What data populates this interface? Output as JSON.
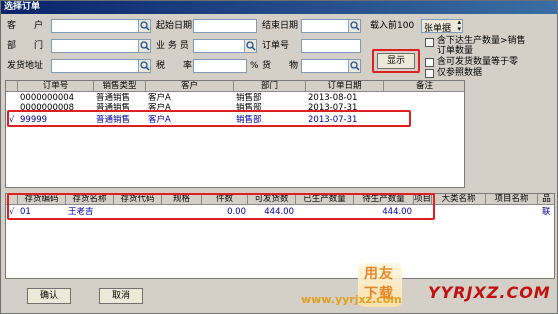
{
  "window": {
    "title": "选择订单"
  },
  "filters": {
    "customer_label": "客　　户",
    "start_date_label": "起始日期",
    "end_date_label": "结束日期",
    "load_prev_label": "载入前100",
    "sheet_sort_value": "张单据",
    "dept_label": "部　　门",
    "salesman_label": "业 务 员",
    "order_no_label": "订单号",
    "ship_addr_label": "发货地址",
    "tax_label": "税　　率",
    "percent_unit": "%",
    "goods_label": "货　　物",
    "show_button": "显示",
    "opt_incl_prod_line1": "含下达生产数量>销售",
    "opt_incl_prod_line2": "订单数量",
    "opt_ship_eq_zero": "含可发货数量等于零",
    "opt_ref_only": "仅参照数据"
  },
  "orders": {
    "columns": [
      "订单号",
      "销售类型",
      "客户",
      "部门",
      "订单日期",
      "备注"
    ],
    "rows": [
      {
        "no": "0000000004",
        "type": "普通销售",
        "customer": "客户A",
        "dept": "销售部",
        "date": "2013-08-01",
        "note": "",
        "checked": ""
      },
      {
        "no": "0000000008",
        "type": "普通销售",
        "customer": "客户A",
        "dept": "销售部",
        "date": "2013-07-31",
        "note": "",
        "checked": ""
      },
      {
        "no": "99999",
        "type": "普通销售",
        "customer": "客户A",
        "dept": "销售部",
        "date": "2013-07-31",
        "note": "",
        "checked": "√"
      }
    ]
  },
  "details": {
    "columns": [
      "存货编码",
      "存货名称",
      "存货代码",
      "规格",
      "件数",
      "可发货数",
      "已生产数量",
      "待生产数量",
      "项目",
      "大类名称",
      "项目名称",
      "品"
    ],
    "rows": [
      {
        "checked": "√",
        "code": "01",
        "name": "王老吉",
        "inv_code": "",
        "spec": "",
        "pieces": "0.00",
        "shippable": "444.00",
        "produced": "",
        "pending": "444.00",
        "project": "",
        "category": "",
        "project_name": "",
        "tail": "联"
      }
    ]
  },
  "footer": {
    "confirm": "确认",
    "cancel": "取消"
  },
  "watermark": {
    "badge_top": "用友",
    "badge_bottom": "下载",
    "url": "www.yyrjxz.com",
    "logo_text": "YYRJXZ.COM"
  },
  "colors": {
    "accent_red": "#e02020",
    "selected_text": "#0000a0"
  }
}
